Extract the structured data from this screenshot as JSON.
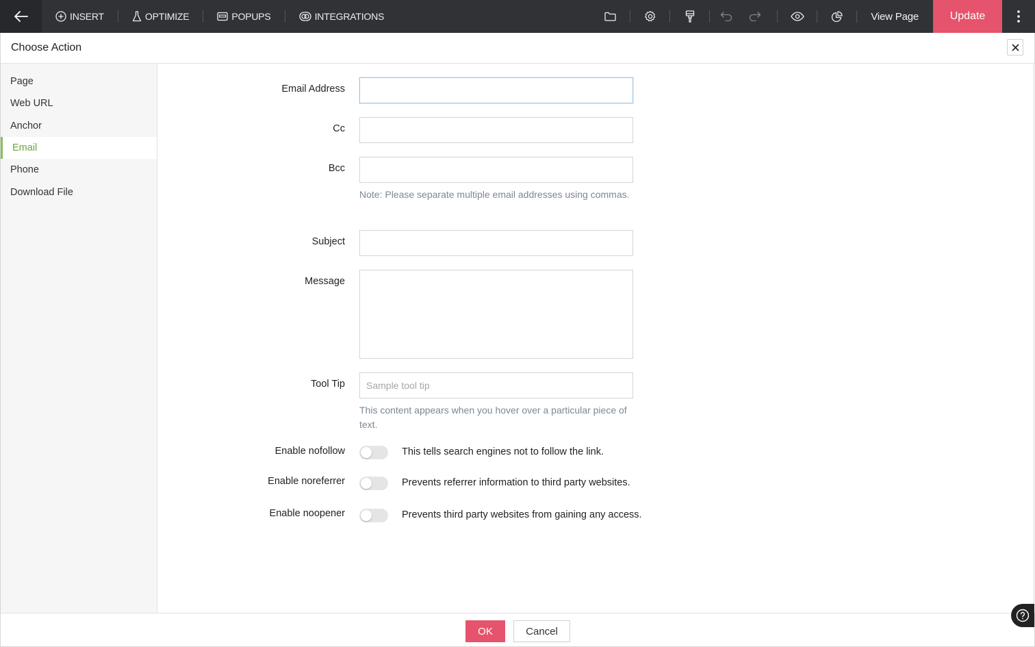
{
  "toolbar": {
    "items": [
      {
        "label": "INSERT",
        "icon": "plus-circle-icon"
      },
      {
        "label": "OPTIMIZE",
        "icon": "flask-icon"
      },
      {
        "label": "POPUPS",
        "icon": "popup-window-icon"
      },
      {
        "label": "INTEGRATIONS",
        "icon": "integrations-icon"
      }
    ],
    "view_page_label": "View Page",
    "update_label": "Update"
  },
  "modal": {
    "title": "Choose Action"
  },
  "sidebar": {
    "items": [
      {
        "label": "Page",
        "active": false
      },
      {
        "label": "Web URL",
        "active": false
      },
      {
        "label": "Anchor",
        "active": false
      },
      {
        "label": "Email",
        "active": true
      },
      {
        "label": "Phone",
        "active": false
      },
      {
        "label": "Download File",
        "active": false
      }
    ]
  },
  "form": {
    "email_label": "Email Address",
    "email_value": "",
    "cc_label": "Cc",
    "cc_value": "",
    "bcc_label": "Bcc",
    "bcc_value": "",
    "bcc_note": "Note: Please separate multiple email addresses using commas.",
    "subject_label": "Subject",
    "subject_value": "",
    "message_label": "Message",
    "message_value": "",
    "tooltip_label": "Tool Tip",
    "tooltip_placeholder": "Sample tool tip",
    "tooltip_note": "This content appears when you hover over a particular piece of text.",
    "nofollow_label": "Enable nofollow",
    "nofollow_desc": "This tells search engines not to follow the link.",
    "nofollow_on": false,
    "noreferrer_label": "Enable noreferrer",
    "noreferrer_desc": "Prevents referrer information to third party websites.",
    "noreferrer_on": false,
    "noopener_label": "Enable noopener",
    "noopener_desc": "Prevents third party websites from gaining any access.",
    "noopener_on": false
  },
  "footer": {
    "ok_label": "OK",
    "cancel_label": "Cancel"
  },
  "colors": {
    "accent": "#e5546c",
    "active_nav": "#6ba53a",
    "toolbar_bg": "#303236"
  }
}
